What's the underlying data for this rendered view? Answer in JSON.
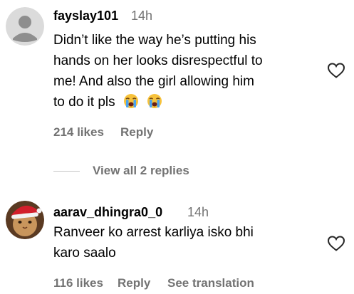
{
  "comments": [
    {
      "username": "fayslay101",
      "time": "14h",
      "text_lines": [
        "Didn’t like the way he’s putting his",
        "hands on her looks disrespectful to",
        "me! And also the girl allowing him",
        "to do it pls"
      ],
      "emoji": [
        "loudly-crying-face",
        "loudly-crying-face"
      ],
      "likes": "214 likes",
      "reply_label": "Reply",
      "view_replies": "View all 2 replies"
    },
    {
      "username": "aarav_dhingra0_0",
      "time": "14h",
      "text_lines": [
        "Ranveer ko arrest karliya isko bhi",
        "karo saalo"
      ],
      "likes": "116 likes",
      "reply_label": "Reply",
      "translation_label": "See translation"
    }
  ],
  "colors": {
    "secondary_text": "#737373",
    "avatar_default_bg": "#dbdbdb",
    "avatar_default_fg": "#8e8e8e"
  },
  "icons": [
    "default-avatar-icon",
    "heart-icon",
    "loudly-crying-face-emoji"
  ]
}
